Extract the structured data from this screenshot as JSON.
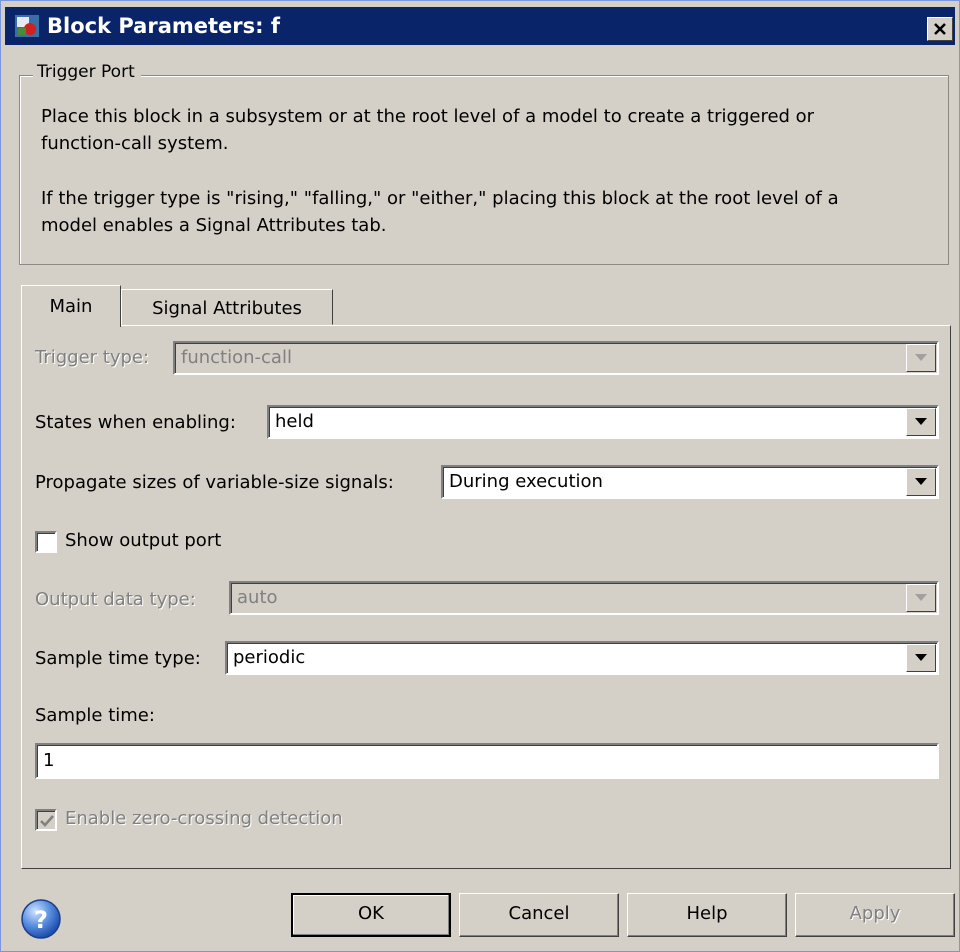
{
  "window": {
    "title": "Block Parameters: f",
    "app_icon": "simulink-block-icon",
    "close_icon": "close-icon"
  },
  "group": {
    "legend": "Trigger Port",
    "description": [
      "Place this block in a subsystem or at the root level of a model to create a triggered or",
      "function-call system.",
      "If the trigger type is \"rising,\" \"falling,\" or \"either,\" placing this block at the root level of a",
      "model enables a Signal Attributes tab."
    ]
  },
  "tabs": [
    {
      "label": "Main",
      "selected": true
    },
    {
      "label": "Signal Attributes",
      "selected": false
    }
  ],
  "main": {
    "trigger_type": {
      "label": "Trigger type:",
      "value": "function-call",
      "enabled": false
    },
    "states_when_enabling": {
      "label": "States when enabling:",
      "value": "held",
      "enabled": true
    },
    "propagate_sizes": {
      "label": "Propagate sizes of variable-size signals:",
      "value": "During execution",
      "enabled": true
    },
    "show_output_port": {
      "label": "Show output port",
      "checked": false,
      "enabled": true
    },
    "output_data_type": {
      "label": "Output data type:",
      "value": "auto",
      "enabled": false
    },
    "sample_time_type": {
      "label": "Sample time type:",
      "value": "periodic",
      "enabled": true
    },
    "sample_time": {
      "label": "Sample time:",
      "value": "1"
    },
    "zero_crossing": {
      "label": "Enable zero-crossing detection",
      "checked": true,
      "enabled": false
    }
  },
  "buttons": {
    "ok": "OK",
    "cancel": "Cancel",
    "help": "Help",
    "apply": "Apply",
    "help_icon": "question-mark-icon"
  },
  "colors": {
    "titlebar": "#0a246a",
    "face": "#d4d0c8",
    "disabled_text": "#808080"
  }
}
